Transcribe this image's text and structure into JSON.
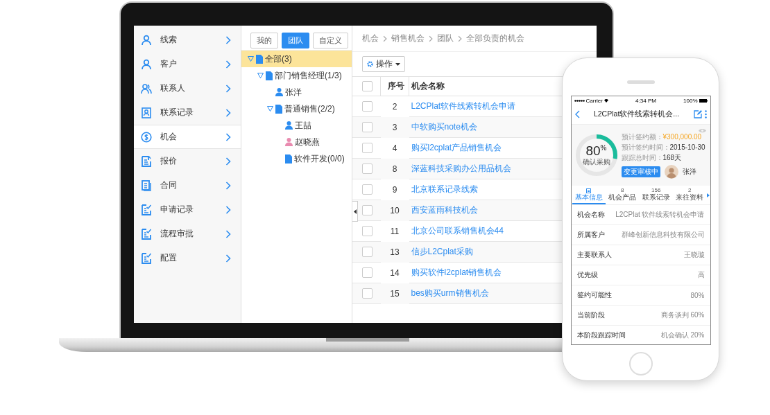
{
  "laptop": {
    "sidebar": {
      "items": [
        {
          "label": "线索",
          "kind": "person",
          "selected": false
        },
        {
          "label": "客户",
          "kind": "person",
          "selected": false
        },
        {
          "label": "联系人",
          "kind": "people",
          "selected": false
        },
        {
          "label": "联系记录",
          "kind": "card",
          "selected": false
        },
        {
          "label": "机会",
          "kind": "money",
          "selected": true
        },
        {
          "label": "报价",
          "kind": "quote",
          "selected": false
        },
        {
          "label": "合同",
          "kind": "contract",
          "selected": false
        },
        {
          "label": "申请记录",
          "kind": "check",
          "selected": false
        },
        {
          "label": "流程审批",
          "kind": "check",
          "selected": false
        },
        {
          "label": "配置",
          "kind": "check",
          "selected": false
        }
      ]
    },
    "filter_tabs": [
      {
        "label": "我的",
        "selected": false
      },
      {
        "label": "团队",
        "selected": true
      },
      {
        "label": "自定义",
        "selected": false
      }
    ],
    "tree": [
      {
        "label": "全部(3)",
        "kind": "folder",
        "expanded": true,
        "selected": true,
        "children": [
          {
            "label": "部门销售经理(1/3)",
            "kind": "folder",
            "expanded": true,
            "selected": false,
            "children": [
              {
                "label": "张洋",
                "kind": "person",
                "color": "#2b8cf0",
                "selected": false
              },
              {
                "label": "普通销售(2/2)",
                "kind": "folder",
                "expanded": true,
                "selected": false,
                "children": [
                  {
                    "label": "王喆",
                    "kind": "person",
                    "color": "#2b8cf0",
                    "selected": false
                  },
                  {
                    "label": "赵晓燕",
                    "kind": "person",
                    "color": "#e98bb0",
                    "selected": false
                  },
                  {
                    "label": "软件开发(0/0)",
                    "kind": "folder",
                    "selected": false
                  }
                ]
              }
            ]
          }
        ]
      }
    ],
    "breadcrumb": [
      "机会",
      "销售机会",
      "团队",
      "全部负责的机会"
    ],
    "action_button": "操作",
    "table": {
      "select_all_checked": false,
      "columns": [
        "序号",
        "机会名称"
      ],
      "rows": [
        {
          "seq": "2",
          "name": "L2CPlat软件线索转机会申请",
          "checked": false
        },
        {
          "seq": "3",
          "name": "中软购买note机会",
          "checked": false
        },
        {
          "seq": "4",
          "name": "购买l2cplat产品销售机会",
          "checked": false
        },
        {
          "seq": "8",
          "name": "深蓝科技采购办公用品机会",
          "checked": false
        },
        {
          "seq": "9",
          "name": "北京联系记录线索",
          "checked": false
        },
        {
          "seq": "10",
          "name": "西安蓝雨科技机会",
          "checked": false
        },
        {
          "seq": "11",
          "name": "北京公司联系销售机会44",
          "checked": false
        },
        {
          "seq": "13",
          "name": "信步L2Cplat采购",
          "checked": false
        },
        {
          "seq": "14",
          "name": "购买软件l2cplat销售机会",
          "checked": false
        },
        {
          "seq": "15",
          "name": "bes购买urm销售机会",
          "checked": false
        }
      ]
    }
  },
  "phone": {
    "status_bar": {
      "carrier": "Carrier",
      "time": "4:34 PM",
      "battery": "100%"
    },
    "title": "L2CPlat软件线索转机会...",
    "summary": {
      "percent": "80$^{%}$",
      "level": 0.28,
      "stage": "确认采购",
      "fields": [
        {
          "label": "预计签约额：",
          "value": "¥300,000.00",
          "kind": "amount"
        },
        {
          "label": "预计签约时间：",
          "value": "2015-10-30",
          "kind": "plain"
        },
        {
          "label": "跟踪总时间：",
          "value": "168天",
          "kind": "plain"
        }
      ],
      "badge": "变更审核中",
      "owner": "张洋"
    },
    "tabs": [
      {
        "label": "基本信息",
        "selected": true
      },
      {
        "label": "机会产品",
        "count": "8",
        "selected": false
      },
      {
        "label": "联系记录",
        "count": "156",
        "selected": false
      },
      {
        "label": "来往资料",
        "count": "2",
        "selected": false
      }
    ],
    "details": [
      {
        "label": "机会名称",
        "value": "L2CPlat 软件线索转机会申请"
      },
      {
        "label": "所属客户",
        "value": "群峰创新信息科技有限公司"
      },
      {
        "label": "主要联系人",
        "value": "王晓璇"
      },
      {
        "label": "优先级",
        "value": "高"
      },
      {
        "label": "签约可能性",
        "value": "80%"
      },
      {
        "label": "当前阶段",
        "value": "商务谈判 60%"
      },
      {
        "label": "本阶段跟踪时间",
        "value": "机会确认 20%"
      }
    ]
  }
}
